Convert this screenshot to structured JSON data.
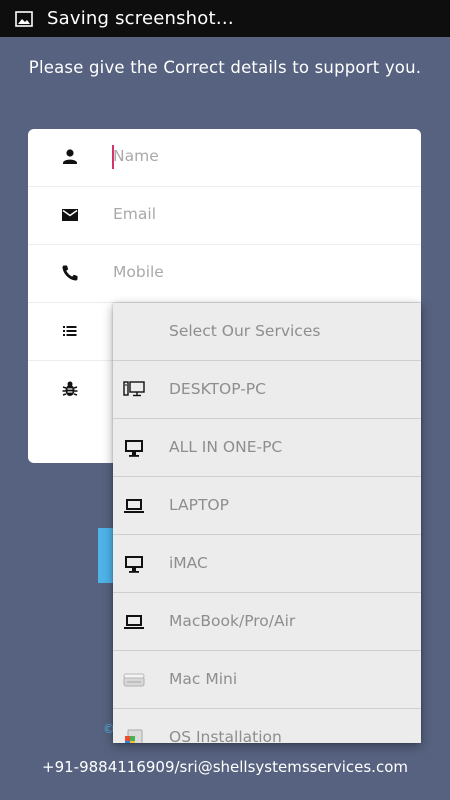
{
  "status_bar": {
    "text": "Saving screenshot…"
  },
  "header": {
    "message": "Please give the Correct details to support you."
  },
  "form": {
    "name_placeholder": "Name",
    "email_placeholder": "Email",
    "mobile_placeholder": "Mobile"
  },
  "services_dropdown": {
    "header": "Select Our Services",
    "options": [
      {
        "label": "DESKTOP-PC",
        "icon": "desktop-pc-icon"
      },
      {
        "label": "ALL IN ONE-PC",
        "icon": "monitor-icon"
      },
      {
        "label": "LAPTOP",
        "icon": "laptop-icon"
      },
      {
        "label": "iMAC",
        "icon": "monitor-icon"
      },
      {
        "label": "MacBook/Pro/Air",
        "icon": "laptop-icon"
      },
      {
        "label": "Mac Mini",
        "icon": "mac-mini-icon"
      },
      {
        "label": "OS Installation",
        "icon": "os-install-icon"
      }
    ]
  },
  "footer": {
    "contact": "+91-9884116909/sri@shellsystemsservices.com"
  }
}
